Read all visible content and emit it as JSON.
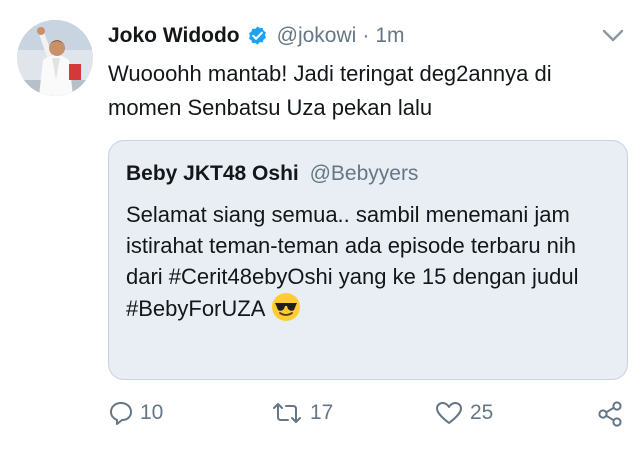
{
  "tweet": {
    "author_name": "Joko Widodo",
    "handle": "@jokowi",
    "separator": "·",
    "time": "1m",
    "text": "Wuooohh mantab! Jadi teringat deg2annya di momen Senbatsu Uza pekan lalu",
    "avatar_icon": "user-avatar",
    "verified_icon": "verified-badge-icon",
    "menu_icon": "chevron-down-icon"
  },
  "quoted_tweet": {
    "author_name": "Beby JKT48 Oshi",
    "handle": "@Bebyyers",
    "text": "Selamat siang semua.. sambil menemani jam istirahat teman-teman ada episode terbaru nih dari #Cerit48ebyOshi yang ke 15 dengan judul #BebyForUZA",
    "emoji_icon": "sunglasses-emoji"
  },
  "actions": {
    "reply_count": "10",
    "retweet_count": "17",
    "like_count": "25"
  },
  "colors": {
    "text": "#14171a",
    "muted": "#657786",
    "verified": "#1da1f2",
    "quote_bg": "#e8eef3",
    "quote_border": "#c9d3da"
  }
}
